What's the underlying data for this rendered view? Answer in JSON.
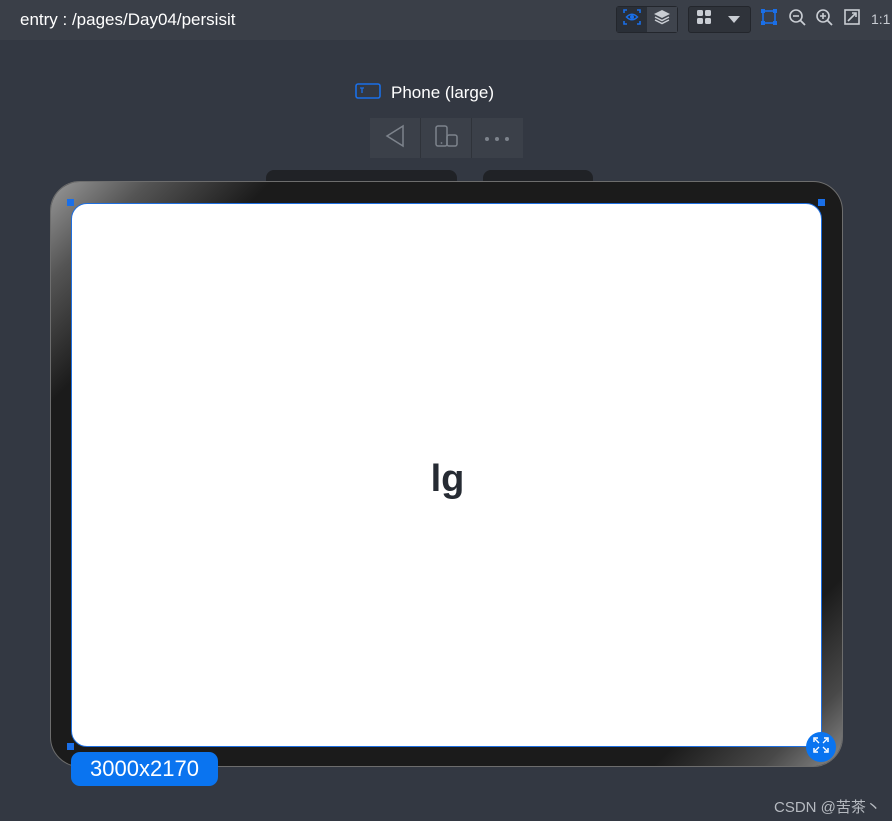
{
  "header": {
    "entry_path": "entry : /pages/Day04/persisit",
    "ratio_label": "1:1"
  },
  "toolbar": {
    "icons": [
      "inspector-eye-icon",
      "layers-icon",
      "grid-apps-icon",
      "dropdown-caret-icon",
      "select-bounds-icon",
      "zoom-out-icon",
      "zoom-in-icon",
      "fit-screen-icon"
    ],
    "accent_color": "#1a6fe8"
  },
  "device": {
    "label": "Phone (large)",
    "label_icon": "tablet-device-icon",
    "controls": [
      "back-triangle-icon",
      "rotate-device-icon",
      "more-icon"
    ]
  },
  "preview": {
    "content_text": "lg",
    "size_label": "3000x2170",
    "expand_icon": "expand-icon"
  },
  "watermark": {
    "text": "CSDN @苦茶丶"
  }
}
